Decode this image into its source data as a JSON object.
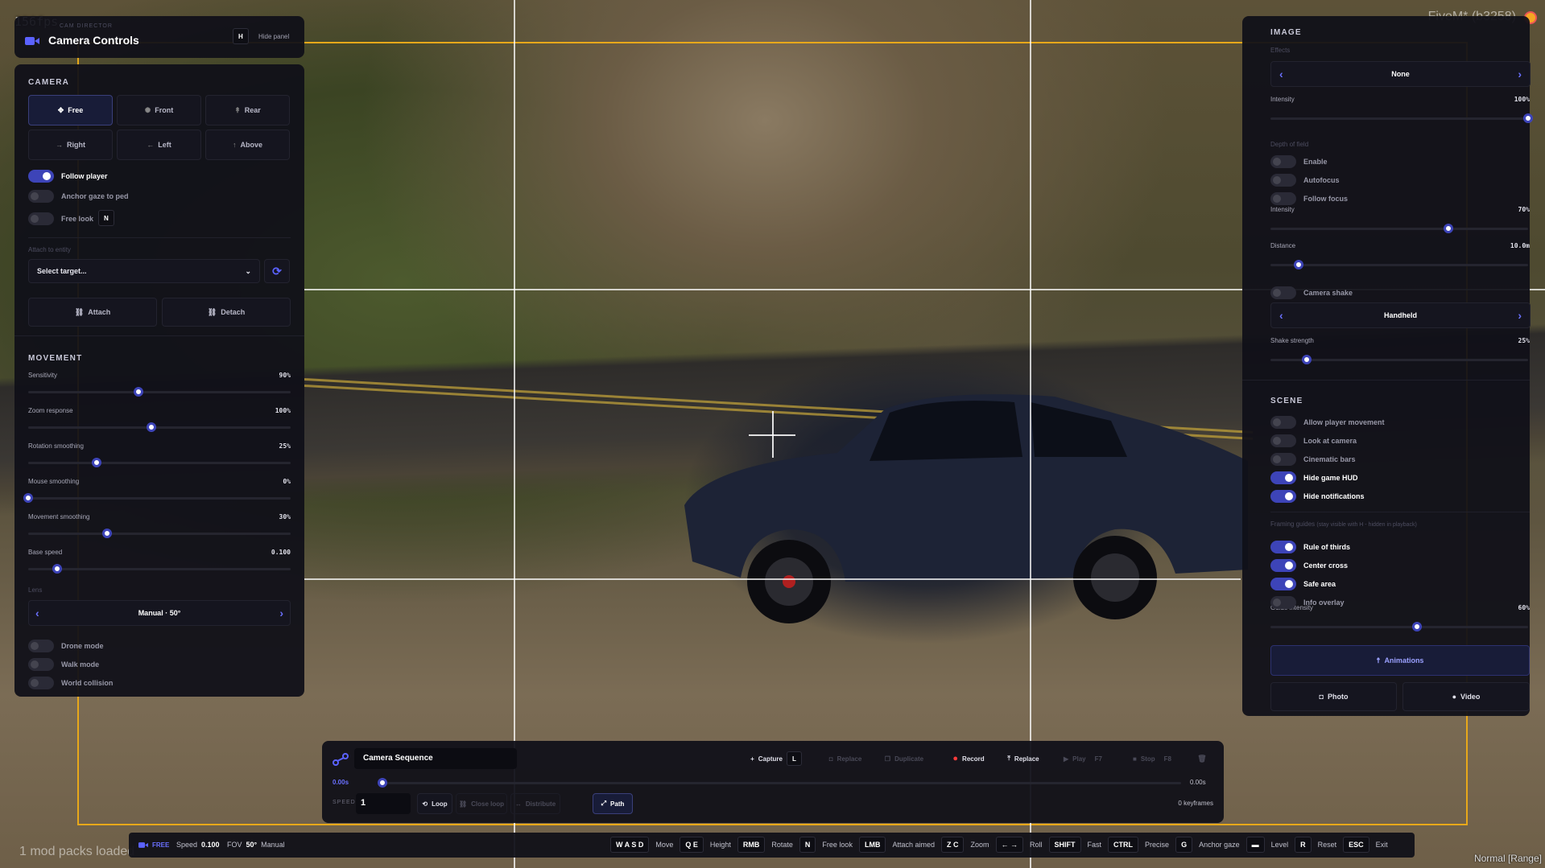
{
  "overlay": {
    "fps": "156fps",
    "fivem": "FiveM* (b3258)",
    "mods_loaded": "1 mod packs loaded",
    "mode_status": "Normal [Range]"
  },
  "left_panel": {
    "app_name": "CAM DIRECTOR",
    "title": "Camera Controls",
    "hide_key": "H",
    "hide_label": "Hide panel",
    "camera_section": "CAMERA",
    "camera_modes": [
      {
        "label": "Free",
        "icon": "move-icon",
        "active": true
      },
      {
        "label": "Front",
        "icon": "sun-icon",
        "active": false
      },
      {
        "label": "Rear",
        "icon": "arrow-up-icon",
        "active": false
      },
      {
        "label": "Right",
        "icon": "arrow-right-icon",
        "active": false
      },
      {
        "label": "Left",
        "icon": "arrow-left-icon",
        "active": false
      },
      {
        "label": "Above",
        "icon": "arrow-up-icon",
        "active": false
      }
    ],
    "toggles": [
      {
        "label": "Follow player",
        "on": true
      },
      {
        "label": "Anchor gaze to ped",
        "on": false
      },
      {
        "label": "Free look",
        "on": false,
        "key": "N"
      }
    ],
    "attach_label": "Attach to entity",
    "target_select": "Select target...",
    "attach_button": "Attach",
    "detach_button": "Detach",
    "movement_section": "MOVEMENT",
    "sliders": [
      {
        "label": "Sensitivity",
        "value": "90%",
        "fraction": 0.42
      },
      {
        "label": "Zoom response",
        "value": "100%",
        "fraction": 0.47
      },
      {
        "label": "Rotation smoothing",
        "value": "25%",
        "fraction": 0.26
      },
      {
        "label": "Mouse smoothing",
        "value": "0%",
        "fraction": 0.0
      },
      {
        "label": "Movement smoothing",
        "value": "30%",
        "fraction": 0.3
      },
      {
        "label": "Base speed",
        "value": "0.100",
        "fraction": 0.11
      }
    ],
    "lens_label": "Lens",
    "lens_value": "Manual · 50°",
    "bottom_toggles": [
      {
        "label": "Drone mode",
        "on": false
      },
      {
        "label": "Walk mode",
        "on": false
      },
      {
        "label": "World collision",
        "on": false
      }
    ]
  },
  "right_panel": {
    "image_section": "IMAGE",
    "effects_label": "Effects",
    "effect_value": "None",
    "intensity_label": "Intensity",
    "intensity_value": "100%",
    "intensity_fraction": 1.0,
    "dof_label": "Depth of field",
    "dof_toggles": [
      {
        "label": "Enable",
        "on": false
      },
      {
        "label": "Autofocus",
        "on": false
      },
      {
        "label": "Follow focus",
        "on": false
      }
    ],
    "dof_intensity_label": "Intensity",
    "dof_intensity_value": "70%",
    "dof_intensity_fraction": 0.69,
    "distance_label": "Distance",
    "distance_value": "10.0m",
    "distance_fraction": 0.11,
    "shake_toggle": {
      "label": "Camera shake",
      "on": false
    },
    "shake_type": "Handheld",
    "shake_strength_label": "Shake strength",
    "shake_strength_value": "25%",
    "shake_strength_fraction": 0.14,
    "scene_section": "SCENE",
    "scene_toggles": [
      {
        "label": "Allow player movement",
        "on": false
      },
      {
        "label": "Look at camera",
        "on": false
      },
      {
        "label": "Cinematic bars",
        "on": false
      },
      {
        "label": "Hide game HUD",
        "on": true
      },
      {
        "label": "Hide notifications",
        "on": true
      }
    ],
    "framing_label": "Framing guides",
    "framing_note": "(stay visible with H - hidden in playback)",
    "framing_toggles": [
      {
        "label": "Rule of thirds",
        "on": true
      },
      {
        "label": "Center cross",
        "on": true
      },
      {
        "label": "Safe area",
        "on": true
      },
      {
        "label": "Info overlay",
        "on": false
      }
    ],
    "guide_intensity_label": "Guide intensity",
    "guide_intensity_value": "60%",
    "guide_intensity_fraction": 0.57,
    "animations_button": "Animations",
    "photo_button": "Photo",
    "video_button": "Video"
  },
  "sequence": {
    "title": "Camera Sequence",
    "capture": "Capture",
    "capture_key": "L",
    "replace_disabled": "Replace",
    "duplicate": "Duplicate",
    "record": "Record",
    "replace": "Replace",
    "play": "Play",
    "play_key": "F7",
    "stop": "Stop",
    "stop_key": "F8",
    "time_start": "0.00s",
    "time_end": "0.00s",
    "speed_label": "SPEED",
    "speed_value": "1",
    "loop": "Loop",
    "close_loop": "Close loop",
    "distribute": "Distribute",
    "path": "Path",
    "keyframes": "0 keyframes"
  },
  "status_bar": {
    "mode": "FREE",
    "speed_label": "Speed",
    "speed_value": "0.100",
    "fov_label": "FOV",
    "fov_value": "50°",
    "fov_mode": "Manual",
    "hints": [
      {
        "key": "W A S D",
        "label": "Move"
      },
      {
        "key": "Q E",
        "label": "Height"
      },
      {
        "key": "RMB",
        "label": "Rotate"
      },
      {
        "key": "N",
        "label": "Free look"
      },
      {
        "key": "LMB",
        "label": "Attach aimed"
      },
      {
        "key": "Z C",
        "label": "Zoom"
      },
      {
        "key": "← →",
        "label": "Roll"
      },
      {
        "key": "SHIFT",
        "label": "Fast"
      },
      {
        "key": "CTRL",
        "label": "Precise"
      },
      {
        "key": "G",
        "label": "Anchor gaze"
      },
      {
        "key": "▬",
        "label": "Level"
      },
      {
        "key": "R",
        "label": "Reset"
      },
      {
        "key": "ESC",
        "label": "Exit"
      }
    ]
  },
  "colors": {
    "accent": "#3d44b8",
    "panel_bg": "#101018",
    "guide": "#e8a81a",
    "record": "#ff3b3b"
  }
}
